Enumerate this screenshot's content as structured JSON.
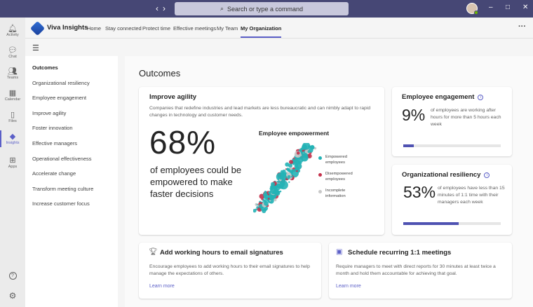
{
  "titlebar": {
    "nav_back": "‹",
    "nav_forward": "›",
    "search_placeholder": "Search or type a command",
    "minimize": "–",
    "maximize": "□",
    "close": "✕"
  },
  "rail": [
    {
      "label": "Activity",
      "icon": "bell-icon",
      "glyph": "🔔︎"
    },
    {
      "label": "Chat",
      "icon": "chat-icon",
      "glyph": "💬︎"
    },
    {
      "label": "Teams",
      "icon": "teams-icon",
      "glyph": "👥︎"
    },
    {
      "label": "Calendar",
      "icon": "calendar-icon",
      "glyph": "▦"
    },
    {
      "label": "Files",
      "icon": "files-icon",
      "glyph": "▯"
    },
    {
      "label": "Insights",
      "icon": "insights-icon",
      "glyph": "◆"
    },
    {
      "label": "Apps",
      "icon": "apps-icon",
      "glyph": "⊞"
    }
  ],
  "rail_bottom": {
    "help": "?",
    "settings": "⚙"
  },
  "app": {
    "name": "Viva Insights",
    "tabs": [
      "Home",
      "Stay connected",
      "Protect time",
      "Effective meetings",
      "My Team",
      "My Organization"
    ],
    "active_tab": "My Organization",
    "more": "···"
  },
  "leftnav": {
    "hamburger": "☰",
    "items": [
      "Outcomes",
      "Organizational resiliency",
      "Employee engagement",
      "Improve agility",
      "Foster innovation",
      "Effective managers",
      "Operational effectiveness",
      "Accelerate change",
      "Transform meeting culture",
      "Increase customer focus"
    ],
    "active": "Outcomes"
  },
  "page_title": "Outcomes",
  "agility": {
    "title": "Improve agility",
    "description": "Companies that redefine industries and lead markets are less bureaucratic and can nimbly adapt to rapid changes in technology and customer needs.",
    "percent": "68%",
    "caption": "of employees could be empowered to make faster decisions",
    "chart_title": "Employee empowerment",
    "legend": [
      {
        "label": "Empowered employees",
        "color": "#23b2b6"
      },
      {
        "label": "Disempowered employees",
        "color": "#c4314b"
      },
      {
        "label": "Incomplete information",
        "color": "#c8c8c8"
      }
    ]
  },
  "engagement": {
    "title": "Employee engagement",
    "percent": "9%",
    "description": "of employees are working after hours for more than 5 hours each week",
    "progress": 0.11,
    "info": "i"
  },
  "resiliency": {
    "title": "Organizational resiliency",
    "percent": "53%",
    "description": "of employees have less than 15 minutes of 1:1 time with their managers each week",
    "progress": 0.57,
    "info": "i"
  },
  "tips": [
    {
      "icon": "trophy-icon",
      "glyph": "🏆︎",
      "title": "Add working hours to email signatures",
      "description": "Encourage employees to add working hours to their email signatures to help manage the expectations of others.",
      "link": "Learn more"
    },
    {
      "icon": "teams-meeting-icon",
      "glyph": "▣",
      "title": "Schedule recurring 1:1 meetings",
      "description": "Require managers to meet with direct reports for 30 minutes at least twice a month and hold them accountable for achieving that goal.",
      "link": "Learn more"
    }
  ]
}
